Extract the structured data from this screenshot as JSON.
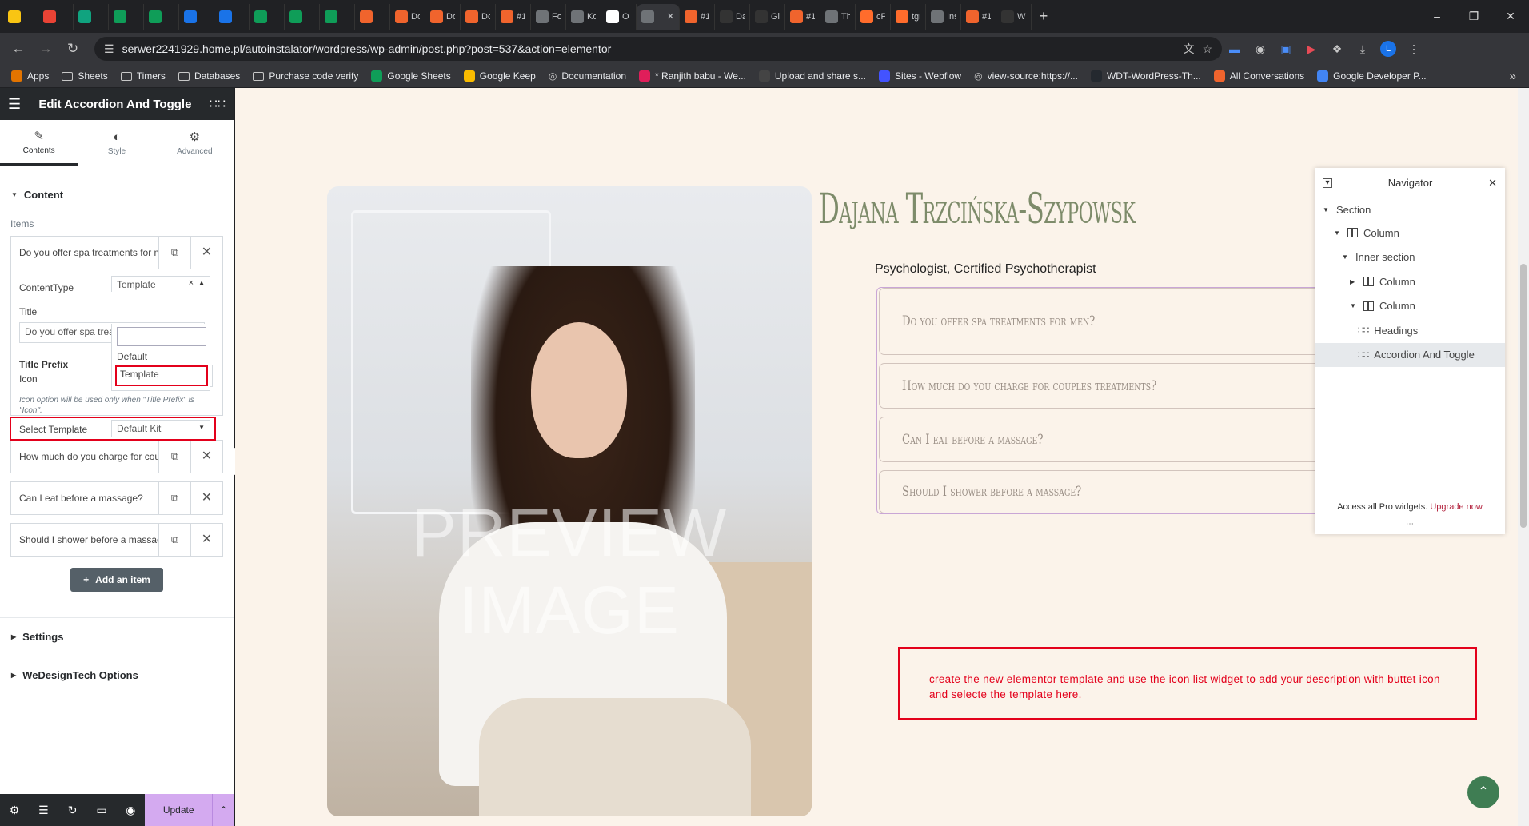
{
  "browser": {
    "tabs": [
      {
        "label": "",
        "color": "#f9c513",
        "icon": "doc-icon"
      },
      {
        "label": "",
        "color": "#ea4335",
        "icon": "gmail-icon"
      },
      {
        "label": "",
        "color": "#10a37f",
        "icon": "chatgpt-icon"
      },
      {
        "label": "",
        "color": "#0f9d58",
        "icon": "sheets-icon"
      },
      {
        "label": "",
        "color": "#0f9d58",
        "icon": "sheets-icon"
      },
      {
        "label": "",
        "color": "#1a73e8",
        "icon": "word-icon"
      },
      {
        "label": "",
        "color": "#1a73e8",
        "icon": "g-icon"
      },
      {
        "label": "",
        "color": "#0f9d58",
        "icon": "sheets-icon"
      },
      {
        "label": "",
        "color": "#0f9d58",
        "icon": "sheets-icon"
      },
      {
        "label": "",
        "color": "#0f9d58",
        "icon": "sheets-icon"
      },
      {
        "label": "",
        "color": "#f0642d",
        "icon": "clickup-icon"
      },
      {
        "label": "Do",
        "color": "#f0642d",
        "icon": "clickup-icon"
      },
      {
        "label": "Do",
        "color": "#f0642d",
        "icon": "clickup-icon"
      },
      {
        "label": "Do",
        "color": "#f0642d",
        "icon": "clickup-icon"
      },
      {
        "label": "#1",
        "color": "#f0642d",
        "icon": "clickup-icon"
      },
      {
        "label": "For",
        "color": "#6f7377",
        "icon": "wordpress-icon"
      },
      {
        "label": "Kol",
        "color": "#6f7377",
        "icon": "globe-icon"
      },
      {
        "label": "O n",
        "color": "#ffffff",
        "icon": "m-icon"
      },
      {
        "label": "",
        "color": "#6f7377",
        "icon": "globe-icon",
        "active": true
      },
      {
        "label": "#1",
        "color": "#f0642d",
        "icon": "clickup-icon"
      },
      {
        "label": "Da",
        "color": "#333333",
        "icon": "globe-icon"
      },
      {
        "label": "Glo",
        "color": "#333333",
        "icon": "globe-icon"
      },
      {
        "label": "#1",
        "color": "#f0642d",
        "icon": "clickup-icon"
      },
      {
        "label": "The",
        "color": "#6f7377",
        "icon": "wordpress-icon"
      },
      {
        "label": "cPa",
        "color": "#ff6c2c",
        "icon": "cpanel-icon"
      },
      {
        "label": "tgr",
        "color": "#ff6c2c",
        "icon": "cpanel-icon"
      },
      {
        "label": "Ins",
        "color": "#6f7377",
        "icon": "wordpress-icon"
      },
      {
        "label": "#1",
        "color": "#f0642d",
        "icon": "clickup-icon"
      },
      {
        "label": "WI",
        "color": "#333333",
        "icon": "globe-icon"
      }
    ],
    "url": "serwer2241929.home.pl/autoinstalator/wordpress/wp-admin/post.php?post=537&action=elementor",
    "profile_initial": "L",
    "bookmarks": [
      {
        "label": "Apps",
        "type": "apps"
      },
      {
        "label": "Sheets",
        "type": "folder"
      },
      {
        "label": "Timers",
        "type": "folder"
      },
      {
        "label": "Databases",
        "type": "folder"
      },
      {
        "label": "Purchase code verify",
        "type": "folder"
      },
      {
        "label": "Google Sheets",
        "type": "site",
        "color": "#0f9d58"
      },
      {
        "label": "Google Keep",
        "type": "site",
        "color": "#f9bb00"
      },
      {
        "label": "Documentation",
        "type": "globe"
      },
      {
        "label": "* Ranjith babu - We...",
        "type": "site",
        "color": "#e01e5a"
      },
      {
        "label": "Upload and share s...",
        "type": "site",
        "color": "#444444"
      },
      {
        "label": "Sites - Webflow",
        "type": "site",
        "color": "#4353ff"
      },
      {
        "label": "view-source:https://...",
        "type": "globe"
      },
      {
        "label": "WDT-WordPress-Th...",
        "type": "site",
        "color": "#24292f"
      },
      {
        "label": "All Conversations",
        "type": "site",
        "color": "#f0642d"
      },
      {
        "label": "Google Developer P...",
        "type": "site",
        "color": "#4285f4"
      }
    ]
  },
  "panel": {
    "title": "Edit Accordion And Toggle",
    "tabs": {
      "content": "Contents",
      "style": "Style",
      "advanced": "Advanced"
    },
    "content_section": "Content",
    "items_label": "Items",
    "items": [
      "Do you offer spa treatments for men?",
      "How much do you charge for couples treatments?",
      "Can I eat before a massage?",
      "Should I shower before a massage?"
    ],
    "open_item": {
      "content_type_label": "ContentType",
      "content_type_value": "Template",
      "title_label": "Title",
      "title_value": "Do you offer spa treatments for men?",
      "dropdown_options": [
        "Default",
        "Template"
      ],
      "title_prefix_label": "Title Prefix",
      "icon_label": "Icon",
      "icon_hint": "Icon option will be used only when \"Title Prefix\" is \"Icon\".",
      "select_template_label": "Select Template",
      "select_template_value": "Default Kit"
    },
    "add_item": "Add an item",
    "settings_section": "Settings",
    "wedesigntech_section": "WeDesignTech Options",
    "update": "Update"
  },
  "page": {
    "watermark": "PREVIEW IMAGE",
    "name": "Dajana Trzcińska-Szypowsk",
    "subtitle": "Psychologist, Certified Psychotherapist",
    "accordion": [
      "Do you offer spa treatments for men?",
      "How much do you charge for couples treatments?",
      "Can I eat before a massage?",
      "Should I shower before a massage?"
    ],
    "note": "create the new elementor template and use the icon list widget to add your description with buttet icon and selecte the template here."
  },
  "navigator": {
    "title": "Navigator",
    "tree": [
      {
        "label": "Section",
        "depth": 0,
        "type": "section"
      },
      {
        "label": "Column",
        "depth": 1,
        "type": "column"
      },
      {
        "label": "Inner section",
        "depth": 2,
        "type": "section"
      },
      {
        "label": "Column",
        "depth": 3,
        "type": "column",
        "collapsed": true
      },
      {
        "label": "Column",
        "depth": 3,
        "type": "column"
      },
      {
        "label": "Headings",
        "depth": 4,
        "type": "widget"
      },
      {
        "label": "Accordion And Toggle",
        "depth": 4,
        "type": "widget",
        "selected": true
      }
    ],
    "footer_text": "Access all Pro widgets.",
    "footer_link": "Upgrade now"
  },
  "colors": {
    "accent_red": "#e3001b",
    "update_button": "#d4aaf0",
    "heading_green": "#7d8b6a",
    "canvas_bg": "#fbf3ea"
  }
}
